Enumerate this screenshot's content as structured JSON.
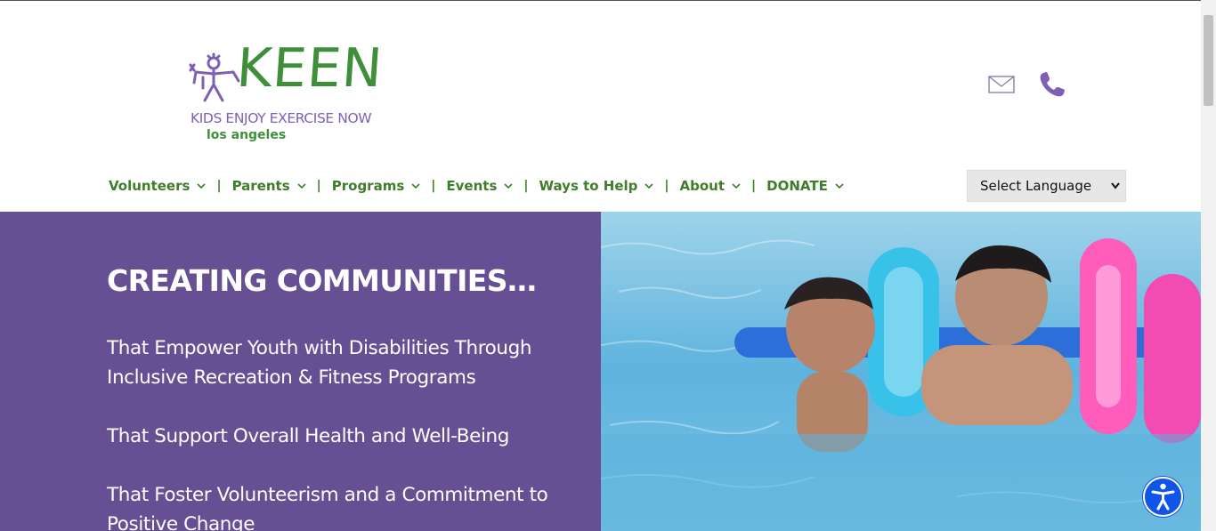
{
  "header": {
    "logo": {
      "wordmark": "KEEN",
      "tagline": "KIDS ENJOY EXERCISE NOW",
      "city": "los angeles"
    },
    "icons": [
      "mail-icon",
      "phone-icon"
    ]
  },
  "nav": {
    "items": [
      {
        "label": "Volunteers"
      },
      {
        "label": "Parents"
      },
      {
        "label": "Programs"
      },
      {
        "label": "Events"
      },
      {
        "label": "Ways to Help"
      },
      {
        "label": "About"
      },
      {
        "label": "DONATE"
      }
    ],
    "separator": "|"
  },
  "language": {
    "selected": "Select Language"
  },
  "hero": {
    "title": "CREATING COMMUNITIES…",
    "lines": [
      "That Empower Youth with Disabilities Through Inclusive Recreation & Fitness Programs",
      "That Support Overall Health and Well-Being",
      "That Foster Volunteerism and a Commitment to Positive Change"
    ]
  },
  "colors": {
    "brand_green": "#3f8f3a",
    "brand_purple": "#674f93",
    "accessibility_blue": "#1155e8"
  }
}
